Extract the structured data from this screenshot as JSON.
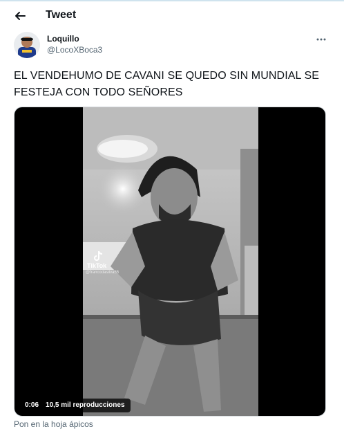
{
  "header": {
    "title": "Tweet",
    "back_icon": "arrow-left-icon"
  },
  "author": {
    "display_name": "Loquillo",
    "handle": "@LocoXBoca3",
    "more_icon": "more-horizontal-icon"
  },
  "tweet": {
    "text": "EL VENDEHUMO DE CAVANI SE QUEDO SIN MUNDIAL SE FESTEJA CON TODO SEÑORES"
  },
  "media": {
    "overlay_logo": "tiktok-logo-icon",
    "overlay_name": "TikTok",
    "overlay_user": "@francodasilva55",
    "time": "0:06",
    "views": "10,5 mil reproducciones"
  },
  "footer": {
    "partial_text": "Pon en la hoja ápicos"
  },
  "colors": {
    "background": "#ffffff",
    "text": "#0f1419",
    "secondary_text": "#536471",
    "media_bg": "#000000"
  }
}
